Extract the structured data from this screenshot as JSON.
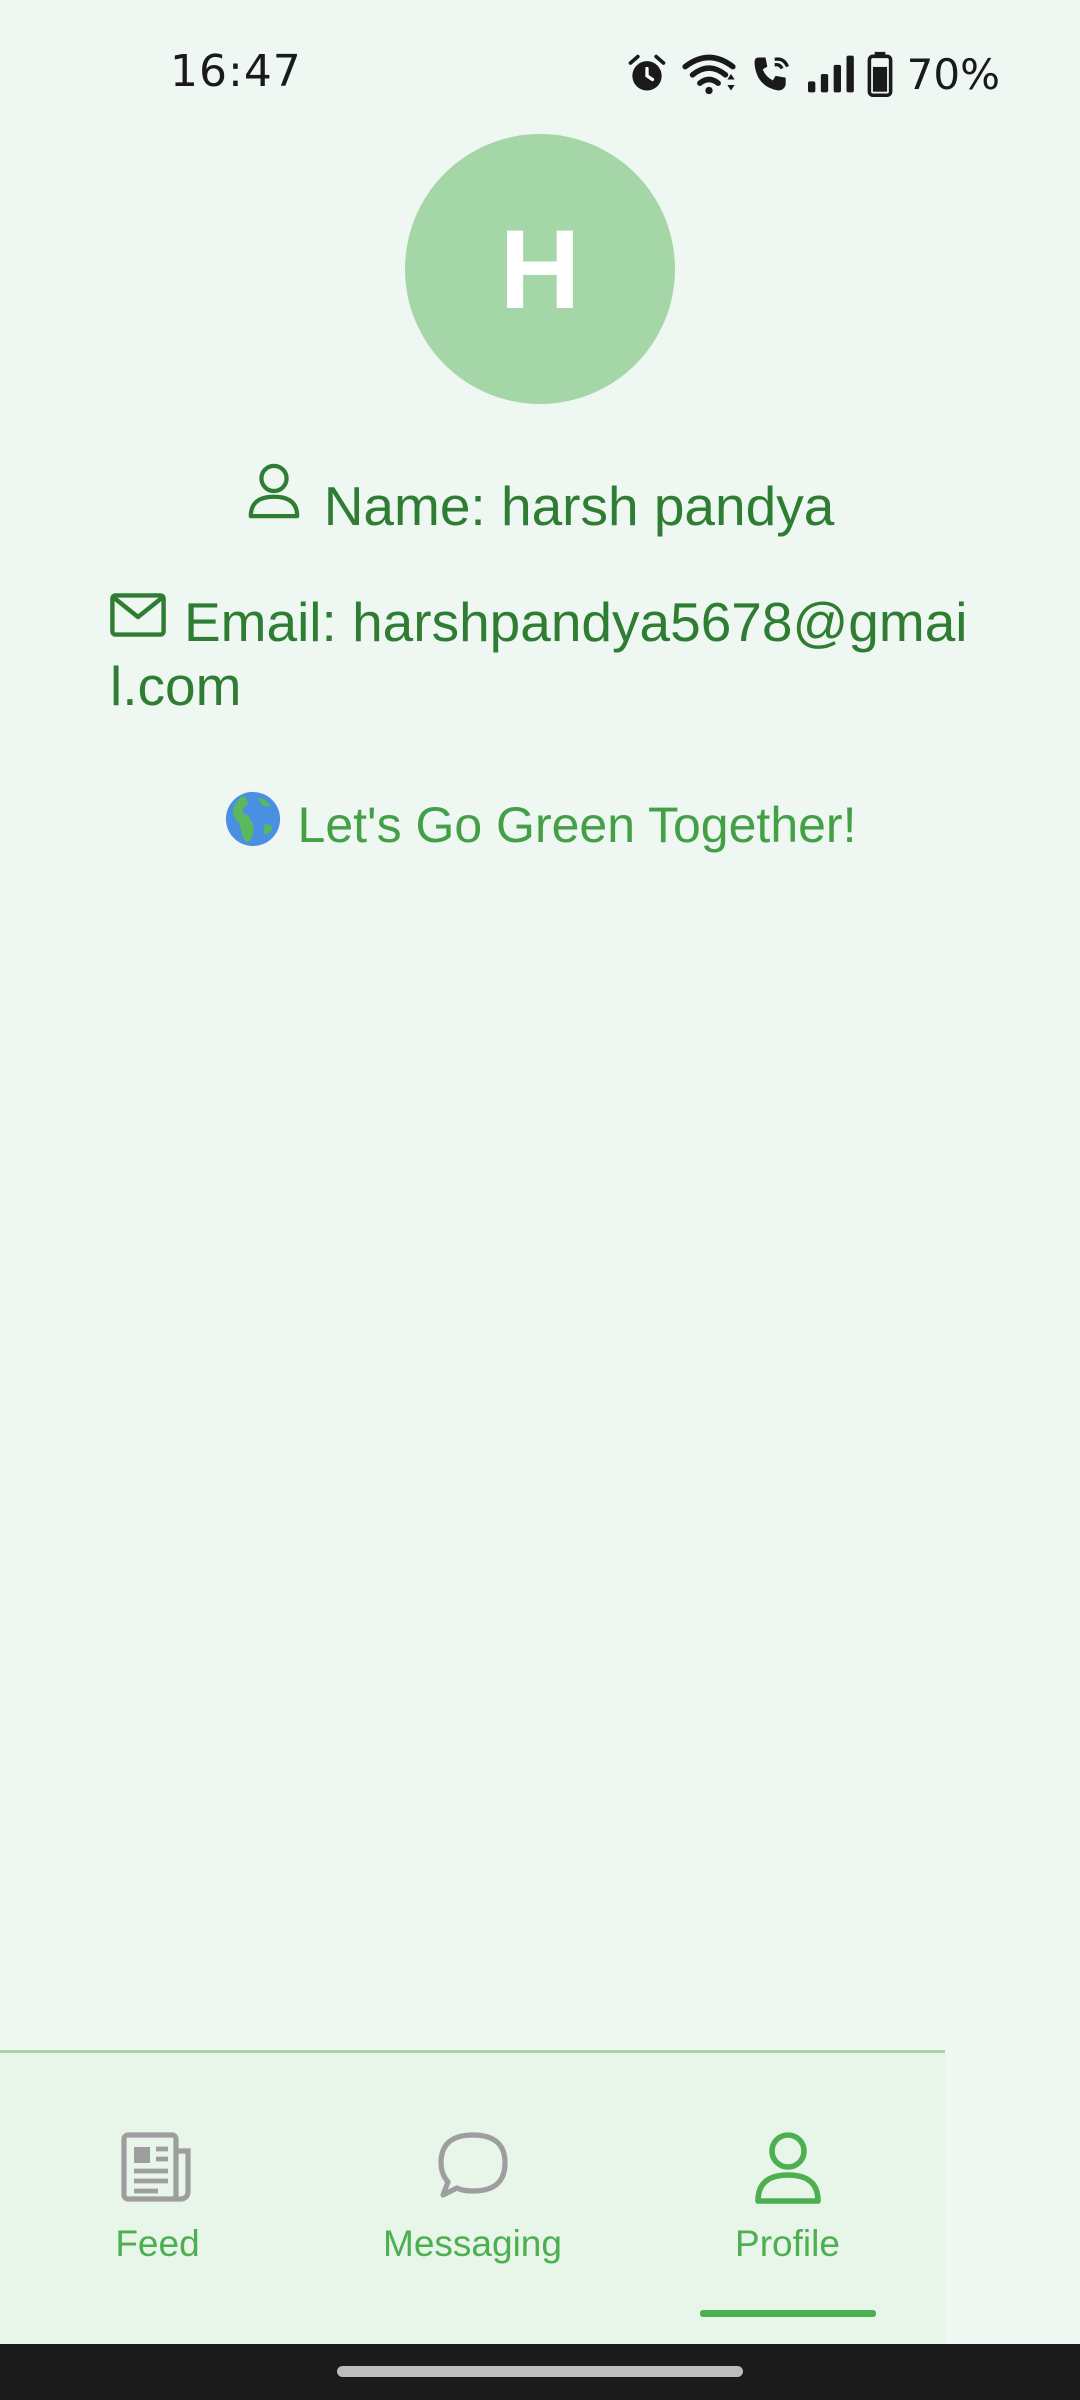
{
  "status_bar": {
    "time": "16:47",
    "battery": "70%",
    "icons": [
      "alarm-icon",
      "wifi-icon",
      "wifi-call-icon",
      "signal-icon",
      "battery-icon"
    ]
  },
  "profile": {
    "avatar_letter": "H",
    "avatar_color": "#a5d6a7",
    "name_text": "Name: harsh pandya",
    "email_text": "Email: harshpandya5678@gmail.com",
    "tagline": "Let's Go Green Together!",
    "tagline_emoji": "🌍"
  },
  "bottom_nav": {
    "items": [
      {
        "label": "Feed",
        "icon": "newspaper-icon",
        "active": false
      },
      {
        "label": "Messaging",
        "icon": "chat-bubble-icon",
        "active": false
      },
      {
        "label": "Profile",
        "icon": "person-icon",
        "active": true
      }
    ]
  },
  "colors": {
    "background": "#eef7f1",
    "text_green": "#2e7d32",
    "accent_green": "#4caf50",
    "nav_background": "#e8f5e9"
  }
}
